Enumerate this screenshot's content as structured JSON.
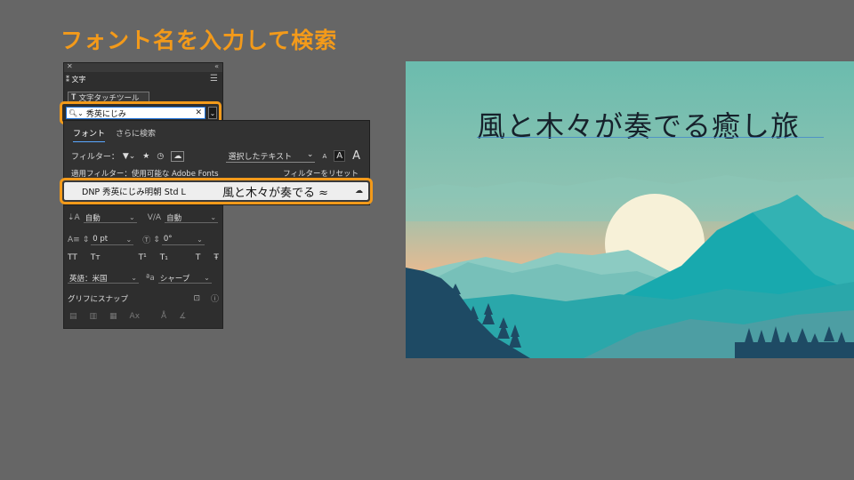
{
  "headline": "フォント名を入力して検索",
  "panel": {
    "title": "文字",
    "touch_tool_label": "文字タッチツール",
    "search": {
      "value": "秀英にじみ"
    },
    "leading": {
      "value": "自動"
    },
    "kerning": {
      "value": "自動"
    },
    "tracking": {
      "value": "0 pt"
    },
    "rotation": {
      "value": "0°"
    },
    "style_buttons": [
      "TT",
      "Tт",
      "T¹",
      "T₁",
      "T",
      "Ŧ"
    ],
    "language": "英語：米国",
    "antialias_prefix": "ªa",
    "antialias": "シャープ",
    "snap_label": "グリフにスナップ"
  },
  "popup": {
    "tabs": [
      "フォント",
      "さらに検索"
    ],
    "filter_label": "フィルター：",
    "sample_text_label": "選択したテキスト",
    "size_labels": [
      "A",
      "A",
      "A"
    ],
    "applied_filter_text": "適用フィルター：使用可能な Adobe Fonts",
    "reset_filter_label": "フィルターをリセット",
    "result": {
      "font_name": "DNP 秀英にじみ明朝 Std L",
      "sample": "風と木々が奏でる ≈"
    }
  },
  "artwork": {
    "title": "風と木々が奏でる癒し旅",
    "colors": {
      "sky_top": "#6bbcae",
      "sky_bottom": "#f3b98d",
      "sun": "#f7f1d8",
      "mountain_far": "#7fc3bb",
      "mountain_teal": "#1aa7ac",
      "forest_dark": "#1e4a64"
    }
  },
  "accent_color": "#f39a1a"
}
